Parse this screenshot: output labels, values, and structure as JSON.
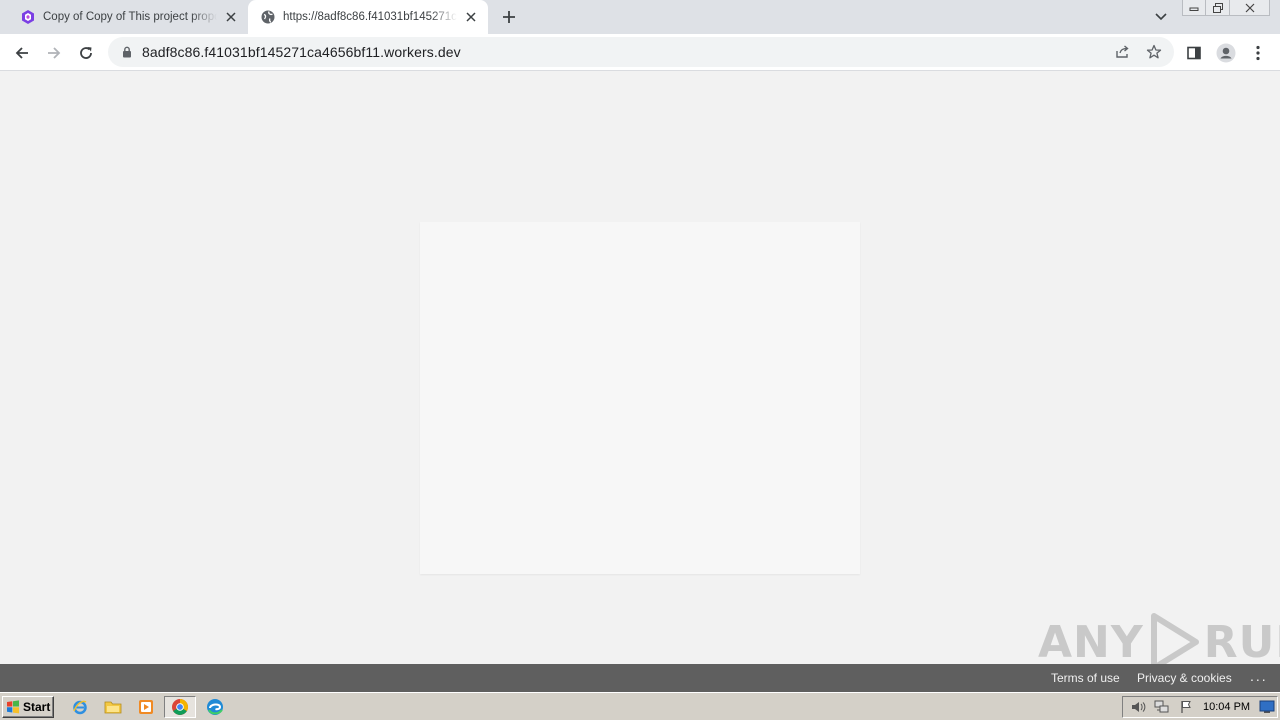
{
  "browser": {
    "tabs": [
      {
        "title": "Copy of Copy of This project propos",
        "favicon": "purple-hexagon-icon",
        "active": false
      },
      {
        "title": "https://8adf8c86.f41031bf145271ca",
        "favicon": "globe-icon",
        "active": true
      }
    ],
    "address_bar": {
      "url": "8adf8c86.f41031bf145271ca4656bf11.workers.dev"
    }
  },
  "footer": {
    "terms_label": "Terms of use",
    "privacy_label": "Privacy & cookies",
    "more_label": "..."
  },
  "watermark": {
    "left_text": "ANY",
    "right_text": "RUN"
  },
  "taskbar": {
    "start_label": "Start",
    "apps": [
      "internet-explorer-icon",
      "file-explorer-icon",
      "media-player-icon",
      "chrome-icon",
      "edge-icon"
    ],
    "clock": "10:04 PM"
  },
  "colors": {
    "footer_bg": "#5f5f5f",
    "tabstrip_bg": "#dee1e6",
    "page_bg": "#f2f2f2"
  }
}
